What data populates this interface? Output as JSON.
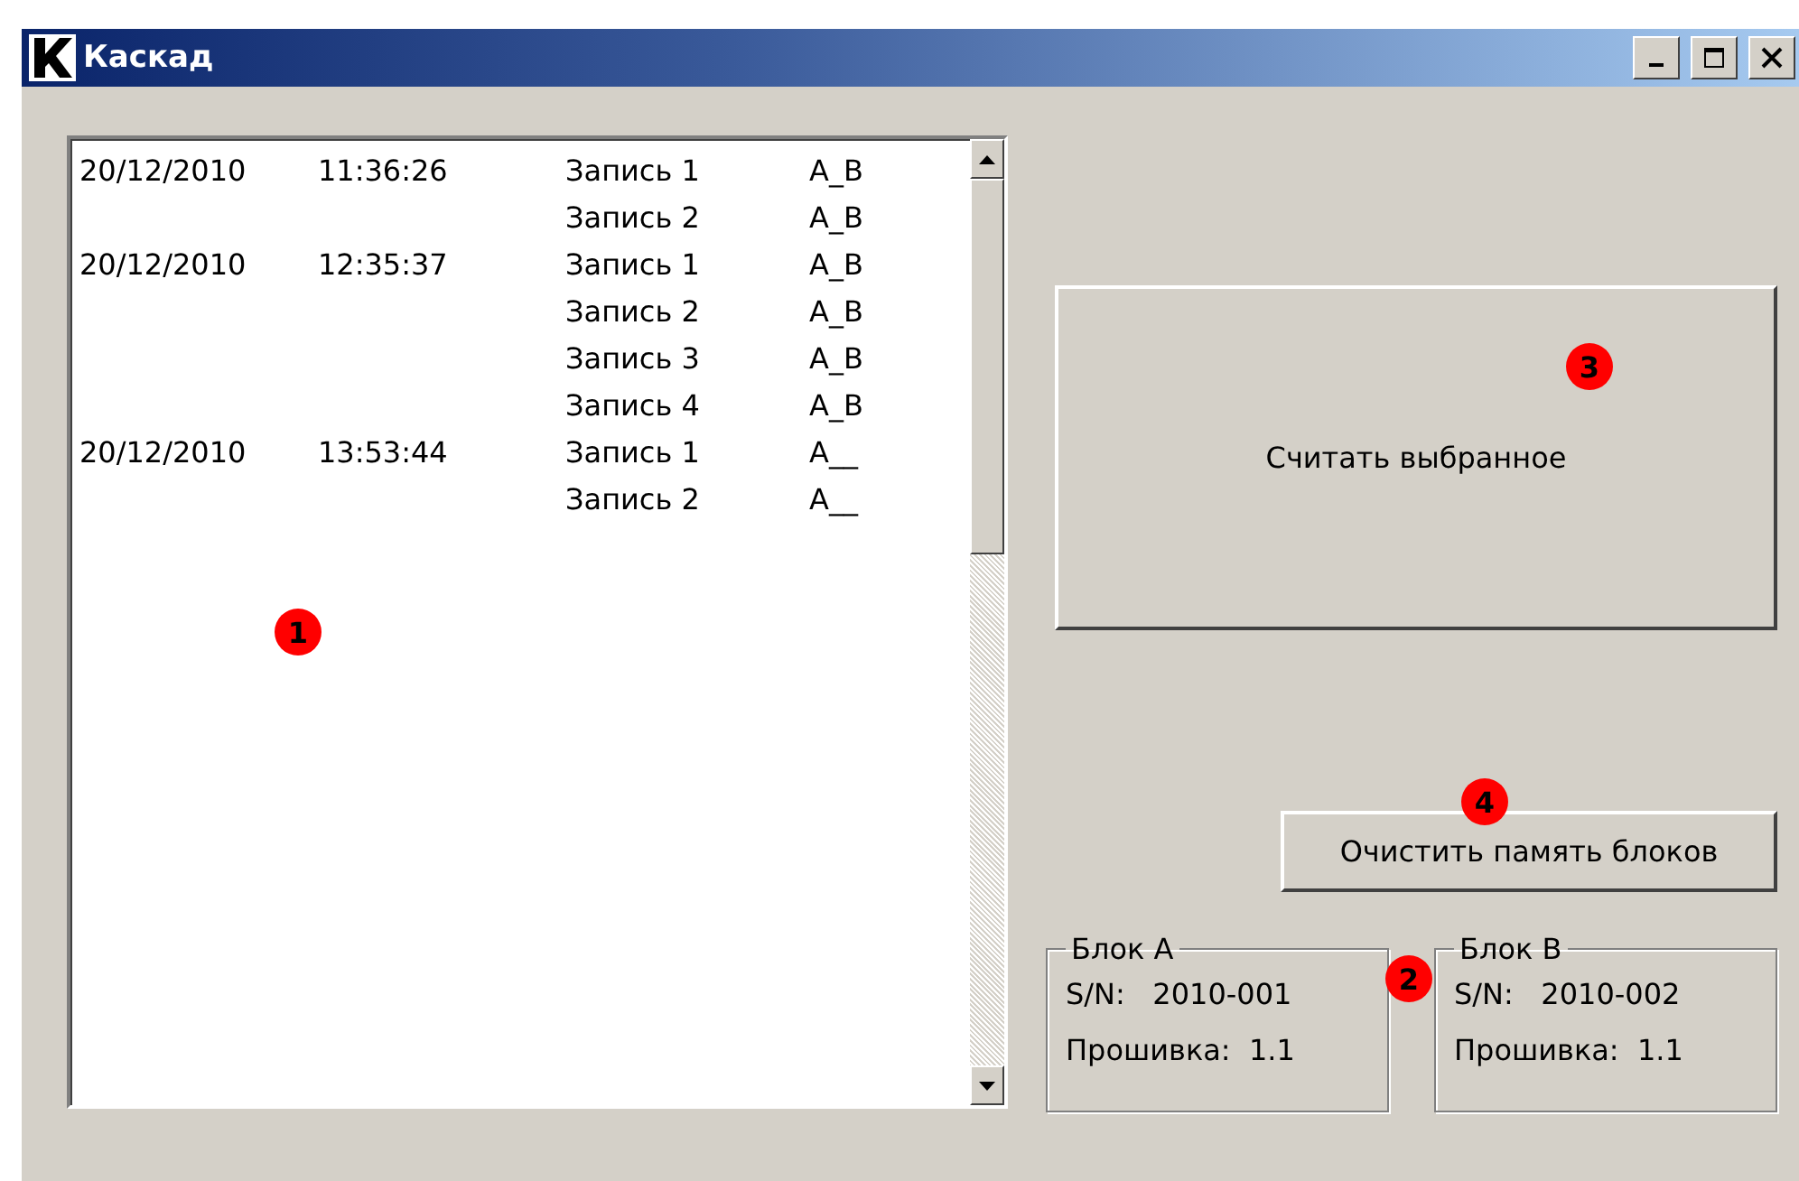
{
  "window": {
    "title": "Каскад"
  },
  "records": [
    {
      "date": "20/12/2010",
      "time": "11:36:26",
      "record": "Запись 1",
      "blocks": "A_B"
    },
    {
      "record": "Запись 2",
      "blocks": "A_B"
    },
    {
      "date": "20/12/2010",
      "time": "12:35:37",
      "record": "Запись 1",
      "blocks": "A_B"
    },
    {
      "record": "Запись 2",
      "blocks": "A_B"
    },
    {
      "record": "Запись 3",
      "blocks": "A_B"
    },
    {
      "record": "Запись 4",
      "blocks": "A_B"
    },
    {
      "date": "20/12/2010",
      "time": "13:53:44",
      "record": "Запись 1",
      "blocks": "A__"
    },
    {
      "record": "Запись 2",
      "blocks": "A__"
    }
  ],
  "read_button": "Считать выбранное",
  "clear_button": "Очистить память блоков",
  "blocks": [
    {
      "title": "Блок A",
      "sn_label": "S/N:",
      "sn": "2010-001",
      "fw_label": "Прошивка:",
      "fw": "1.1"
    },
    {
      "title": "Блок B",
      "sn_label": "S/N:",
      "sn": "2010-002",
      "fw_label": "Прошивка:",
      "fw": "1.1"
    }
  ],
  "markers": [
    {
      "label": "1"
    },
    {
      "label": "2"
    },
    {
      "label": "3"
    },
    {
      "label": "4"
    }
  ]
}
